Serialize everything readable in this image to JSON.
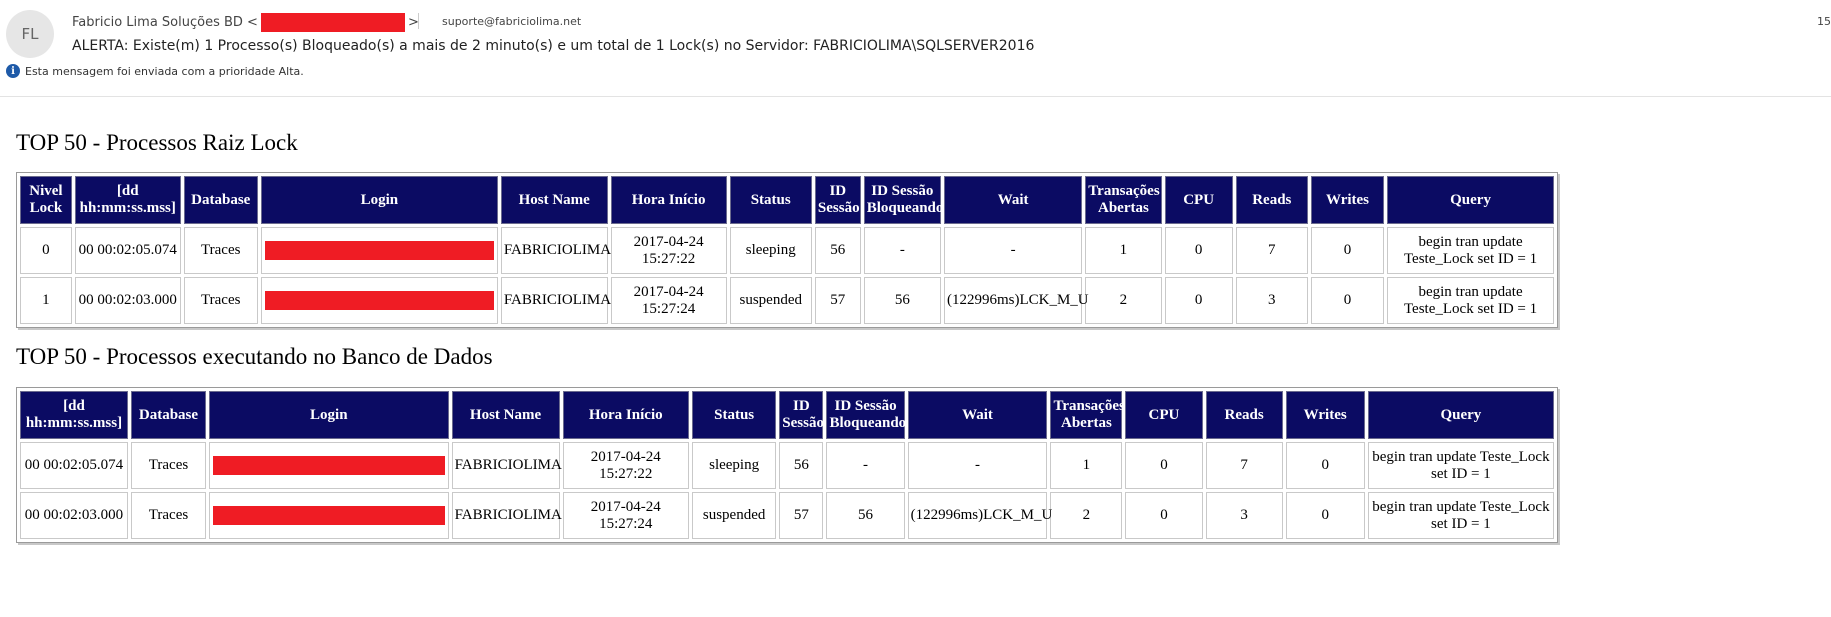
{
  "email": {
    "avatar_initials": "FL",
    "sender_name": "Fabricio Lima Soluções BD <",
    "sender_suffix": ">",
    "recipient": "suporte@fabriciolima.net",
    "time": "15",
    "subject": "ALERTA: Existe(m) 1 Processo(s) Bloqueado(s) a mais de 2 minuto(s) e um total de 1 Lock(s) no Servidor: FABRICIOLIMA\\SQLSERVER2016",
    "priority_notice": "Esta mensagem foi enviada com a prioridade Alta.",
    "redaction_color": "#ef1c24",
    "header_color": "#0b0b63"
  },
  "section1": {
    "title": "TOP 50 - Processos Raiz Lock",
    "headers": [
      "Nivel Lock",
      "[dd hh:mm:ss.mss]",
      "Database",
      "Login",
      "Host Name",
      "Hora Início",
      "Status",
      "ID Sessão",
      "ID Sessão Bloqueando",
      "Wait",
      "Transações Abertas",
      "CPU",
      "Reads",
      "Writes",
      "Query"
    ],
    "rows": [
      [
        "0",
        "00 00:02:05.074",
        "Traces",
        "",
        "FABRICIOLIMA",
        "2017-04-24 15:27:22",
        "sleeping",
        "56",
        "-",
        "-",
        "1",
        "0",
        "7",
        "0",
        "begin tran update Teste_Lock set ID = 1"
      ],
      [
        "1",
        "00 00:02:03.000",
        "Traces",
        "",
        "FABRICIOLIMA",
        "2017-04-24 15:27:24",
        "suspended",
        "57",
        "56",
        "(122996ms)LCK_M_U",
        "2",
        "0",
        "3",
        "0",
        "begin tran update Teste_Lock set ID = 1"
      ]
    ]
  },
  "section2": {
    "title": "TOP 50 - Processos executando no Banco de Dados",
    "headers": [
      "[dd hh:mm:ss.mss]",
      "Database",
      "Login",
      "Host Name",
      "Hora Início",
      "Status",
      "ID Sessão",
      "ID Sessão Bloqueando",
      "Wait",
      "Transações Abertas",
      "CPU",
      "Reads",
      "Writes",
      "Query"
    ],
    "rows": [
      [
        "00 00:02:05.074",
        "Traces",
        "",
        "FABRICIOLIMA",
        "2017-04-24 15:27:22",
        "sleeping",
        "56",
        "-",
        "-",
        "1",
        "0",
        "7",
        "0",
        "begin tran update Teste_Lock set ID = 1"
      ],
      [
        "00 00:02:03.000",
        "Traces",
        "",
        "FABRICIOLIMA",
        "2017-04-24 15:27:24",
        "suspended",
        "57",
        "56",
        "(122996ms)LCK_M_U",
        "2",
        "0",
        "3",
        "0",
        "begin tran update Teste_Lock set ID = 1"
      ]
    ]
  }
}
